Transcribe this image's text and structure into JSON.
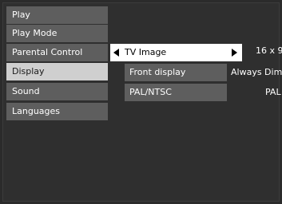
{
  "main_menu": {
    "items": [
      {
        "label": "Play"
      },
      {
        "label": "Play Mode"
      },
      {
        "label": "Parental Control"
      },
      {
        "label": "Display"
      },
      {
        "label": "Sound"
      },
      {
        "label": "Languages"
      }
    ],
    "selected_index": 3
  },
  "sub_menu": {
    "items": [
      {
        "label": "TV Image",
        "value": "16 x 9"
      },
      {
        "label": "Front display",
        "value": "Always Dim"
      },
      {
        "label": "PAL/NTSC",
        "value": "PAL"
      }
    ],
    "highlighted_index": 0
  },
  "icons": [
    "arrow-left-icon",
    "arrow-right-icon"
  ]
}
